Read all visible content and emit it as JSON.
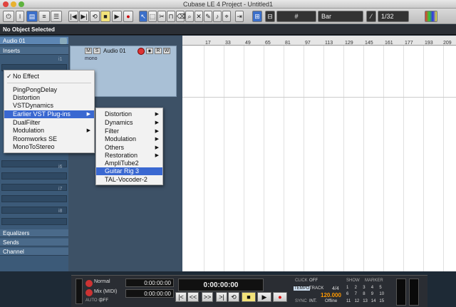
{
  "window": {
    "title": "Cubase LE 4 Project - Untitled1"
  },
  "toolbar": {
    "snap_type": "Bar",
    "quantize": "1/32",
    "grid_symbol": "#"
  },
  "info_line": "No Object Selected",
  "inspector": {
    "track_name": "Audio 01",
    "inserts_label": "Inserts",
    "slot_numbers": [
      "i1",
      "i6",
      "i7",
      "i8"
    ],
    "equalizers_label": "Equalizers",
    "sends_label": "Sends",
    "channel_label": "Channel"
  },
  "track": {
    "name": "Audio 01",
    "btn_m": "M",
    "btn_s": "S",
    "btn_r": "R",
    "btn_w": "W",
    "mode": "mono"
  },
  "ruler": {
    "ticks": [
      "17",
      "33",
      "49",
      "65",
      "81",
      "97",
      "113",
      "129",
      "145",
      "161",
      "177",
      "193",
      "209"
    ]
  },
  "effect_menu": {
    "items": [
      {
        "label": "No Effect",
        "checked": true
      },
      {
        "label": "PingPongDelay"
      },
      {
        "label": "Distortion"
      },
      {
        "label": "VSTDynamics"
      },
      {
        "label": "Earlier VST Plug-ins",
        "submenu": true,
        "selected": true
      },
      {
        "label": "DualFilter"
      },
      {
        "label": "Modulation",
        "submenu": true
      },
      {
        "label": "Roomworks SE"
      },
      {
        "label": "MonoToStereo"
      }
    ]
  },
  "sub_menu": {
    "items": [
      {
        "label": "Distortion",
        "submenu": true
      },
      {
        "label": "Dynamics",
        "submenu": true
      },
      {
        "label": "Filter",
        "submenu": true
      },
      {
        "label": "Modulation",
        "submenu": true
      },
      {
        "label": "Others",
        "submenu": true
      },
      {
        "label": "Restoration",
        "submenu": true
      },
      {
        "label": "AmpliTube2"
      },
      {
        "label": "Guitar Rig 3",
        "selected": true
      },
      {
        "label": "TAL-Vocoder-2"
      }
    ]
  },
  "transport": {
    "mode": "Normal",
    "mix": "Mix (MIDI)",
    "auto_q": "AUTO Q",
    "auto_q_state": "OFF",
    "left_locator": "0:00:00:00",
    "right_locator": "0:00:00:00",
    "position": "0:00:00:00",
    "click_label": "CLICK",
    "click_state": "OFF",
    "tempo_label": "TEMPO",
    "track_label": "TRACK",
    "signature": "4/4",
    "tempo": "120.000",
    "sync_label": "SYNC",
    "sync_int": "INT.",
    "offline": "Offline",
    "show_label": "SHOW",
    "marker_label": "MARKER",
    "markers": [
      "1",
      "2",
      "3",
      "4",
      "5",
      "6",
      "7",
      "8",
      "9",
      "10",
      "11",
      "12",
      "13",
      "14",
      "15"
    ],
    "buttons": {
      "rewind_start": "|<",
      "rewind": "<<",
      "forward": ">>",
      "end": ">|",
      "cycle": "⟲",
      "stop": "■",
      "play": "▶",
      "record": "●"
    }
  }
}
